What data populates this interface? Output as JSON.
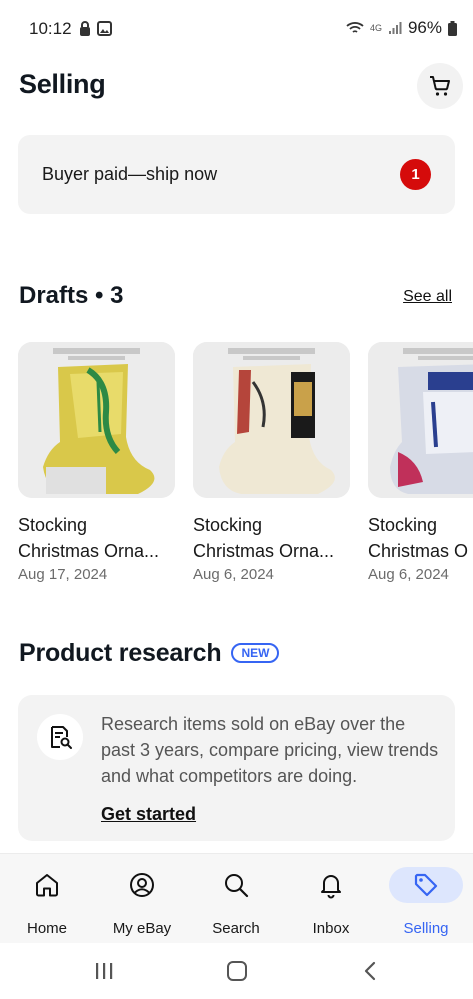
{
  "status_bar": {
    "time": "10:12",
    "network": "4G",
    "battery": "96%"
  },
  "header": {
    "title": "Selling",
    "cart_icon": "cart-icon"
  },
  "banner": {
    "text": "Buyer paid—ship now",
    "count": "1"
  },
  "drafts": {
    "title": "Drafts • 3",
    "see_all_label": "See all",
    "items": [
      {
        "title": "Stocking Christmas Orna...",
        "line1": "Stocking",
        "line2": "Christmas Orna...",
        "date": "Aug 17, 2024",
        "image_theme": "yellow-green"
      },
      {
        "title": "Stocking Christmas Orna...",
        "line1": "Stocking",
        "line2": "Christmas Orna...",
        "date": "Aug 6, 2024",
        "image_theme": "cream-black"
      },
      {
        "title": "Stocking Christmas O",
        "line1": "Stocking",
        "line2": "Christmas O",
        "date": "Aug 6, 2024",
        "image_theme": "blue-white"
      }
    ]
  },
  "research": {
    "title": "Product research",
    "badge": "NEW",
    "description": "Research items sold on eBay over the past 3 years, compare pricing, view trends and what competitors are doing.",
    "cta": "Get started"
  },
  "bottom_nav": {
    "items": [
      {
        "label": "Home",
        "icon": "home-icon"
      },
      {
        "label": "My eBay",
        "icon": "user-circle-icon"
      },
      {
        "label": "Search",
        "icon": "search-icon"
      },
      {
        "label": "Inbox",
        "icon": "bell-icon"
      },
      {
        "label": "Selling",
        "icon": "tag-icon",
        "active": true
      }
    ]
  },
  "colors": {
    "accent": "#3665f3",
    "badge_red": "#d50b0b",
    "card_bg": "#f3f3f3"
  }
}
